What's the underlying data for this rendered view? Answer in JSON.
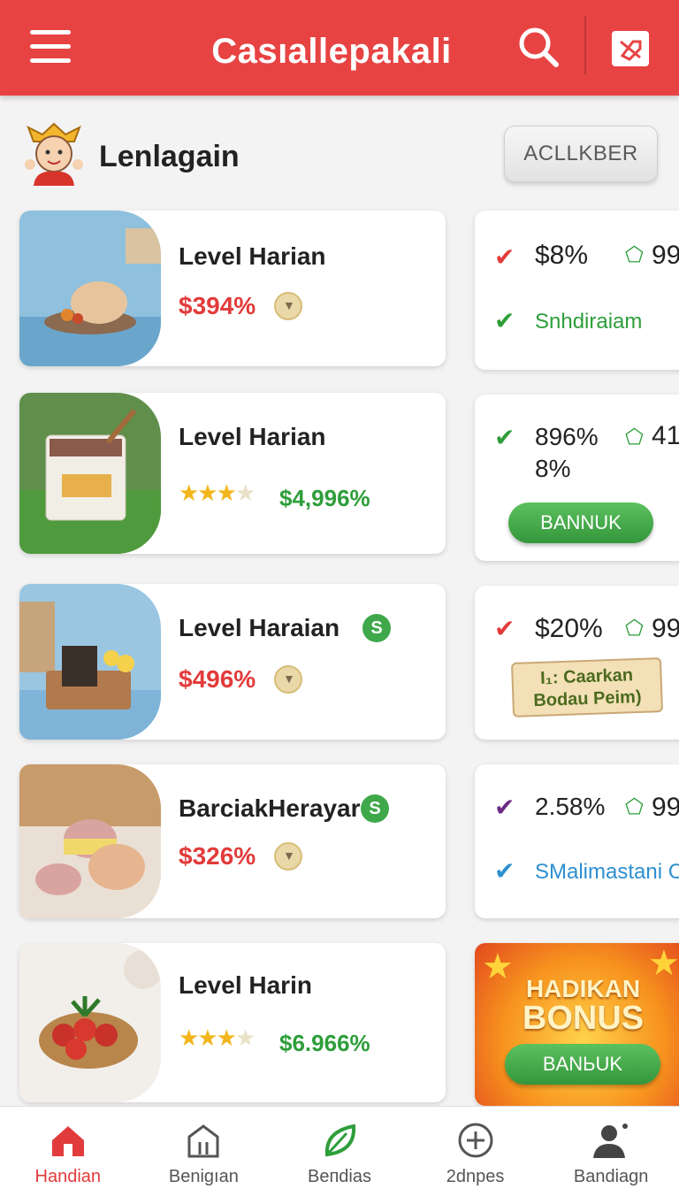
{
  "header": {
    "title": "Casıallepakali",
    "menu_icon": "hamburger-icon",
    "search_icon": "search-icon",
    "tag_icon": "tag-icon"
  },
  "profile": {
    "name": "Lenlagain",
    "button_label": "ACLLKBER"
  },
  "items": [
    {
      "title": "Level Harian",
      "price": "$394%",
      "kind": "price"
    },
    {
      "title": "Level Harian",
      "price": "$4,996%",
      "kind": "stars",
      "rating": 3
    },
    {
      "title": "Level Haraian",
      "price": "$496%",
      "kind": "price",
      "badge": "S"
    },
    {
      "title": "BarciakHerayar",
      "price": "$326%",
      "kind": "price",
      "badge": "S"
    },
    {
      "title": "Level Harin",
      "price": "$6.966%",
      "kind": "stars",
      "rating": 3
    }
  ],
  "side_cards": [
    {
      "stat": "$8%",
      "extra": "99",
      "note": "Snhdiraiam"
    },
    {
      "stat_line1": "896%",
      "stat_line2": "8%",
      "extra": "41",
      "button": "BANNUK"
    },
    {
      "stat": "$20%",
      "extra": "99",
      "scroll_line1": "I₁: Caarkan",
      "scroll_line2": "Bodau Peim)"
    },
    {
      "stat": "2.58%",
      "extra": "99",
      "note": "SMalimastani C"
    },
    {
      "bonus_line1": "HADIKAN",
      "bonus_line2": "BONUS",
      "button": "BANЬUK"
    }
  ],
  "nav": [
    {
      "label": "Handian",
      "icon": "home-icon",
      "active": true
    },
    {
      "label": "Benigıan",
      "icon": "building-icon",
      "active": false
    },
    {
      "label": "Beпdias",
      "icon": "leaf-icon",
      "active": false
    },
    {
      "label": "2dnpes",
      "icon": "plus-circle-icon",
      "active": false
    },
    {
      "label": "Bandiagn",
      "icon": "profile-icon",
      "active": false
    }
  ],
  "colors": {
    "header": "#e84343",
    "price": "#e23b3b",
    "green": "#2e9e3a",
    "blue": "#2d8fd0"
  }
}
